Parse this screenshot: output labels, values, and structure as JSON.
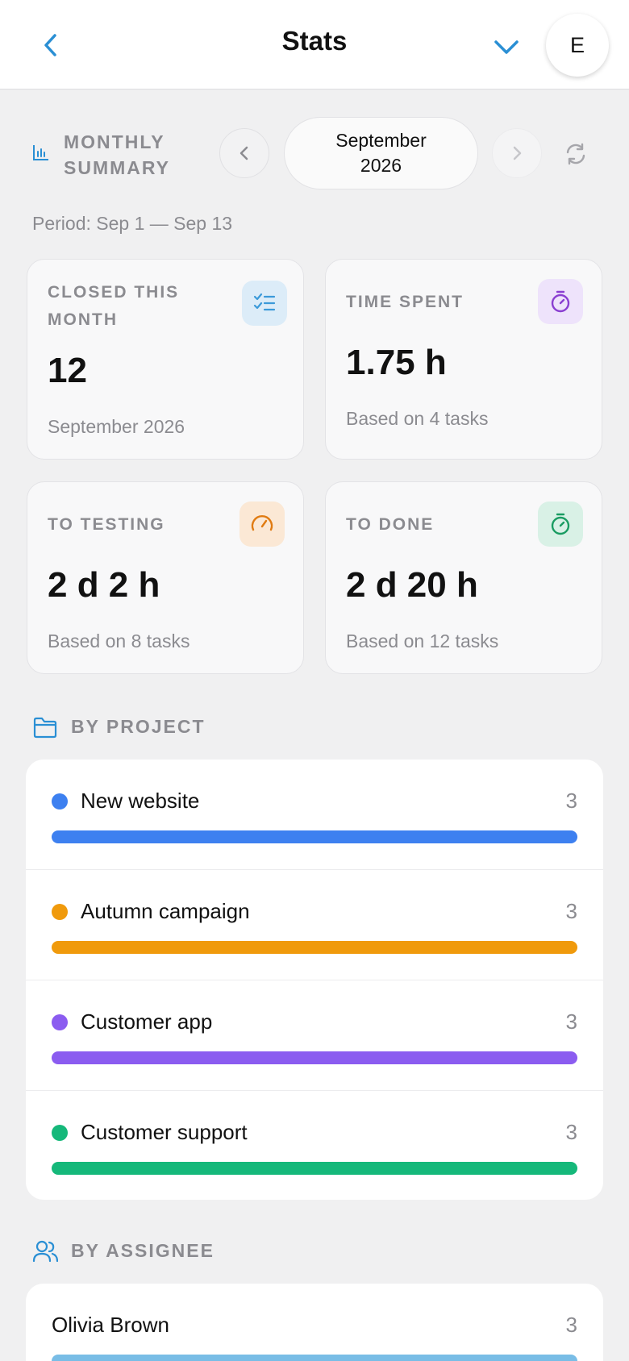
{
  "header": {
    "title": "Stats",
    "avatar_initial": "E"
  },
  "summary": {
    "label": "MONTHLY SUMMARY",
    "month": "September 2026",
    "period": "Period: Sep 1 — Sep 13"
  },
  "cards": {
    "closed": {
      "label": "CLOSED THIS MONTH",
      "value": "12",
      "sub": "September 2026",
      "icon": "checklist-icon",
      "color": "#3b9ad9"
    },
    "time": {
      "label": "TIME SPENT",
      "value": "1.75 h",
      "sub": "Based on 4 tasks",
      "icon": "stopwatch-icon",
      "color": "#8a3fd1"
    },
    "testing": {
      "label": "TO TESTING",
      "value": "2 d 2 h",
      "sub": "Based on 8 tasks",
      "icon": "gauge-icon",
      "color": "#e07b12"
    },
    "done": {
      "label": "TO DONE",
      "value": "2 d 20 h",
      "sub": "Based on 12 tasks",
      "icon": "timer-icon",
      "color": "#1a9c62"
    }
  },
  "by_project": {
    "label": "BY PROJECT",
    "items": [
      {
        "name": "New website",
        "count": "3",
        "color": "#3d80f0",
        "fill": 1.0
      },
      {
        "name": "Autumn campaign",
        "count": "3",
        "color": "#f09a0c",
        "fill": 1.0
      },
      {
        "name": "Customer app",
        "count": "3",
        "color": "#8b5cf0",
        "fill": 1.0
      },
      {
        "name": "Customer support",
        "count": "3",
        "color": "#15b87a",
        "fill": 1.0
      }
    ]
  },
  "by_assignee": {
    "label": "BY ASSIGNEE",
    "items": [
      {
        "name": "Olivia Brown",
        "count": "3",
        "color": "#79bde6",
        "fill": 1.0
      }
    ]
  }
}
